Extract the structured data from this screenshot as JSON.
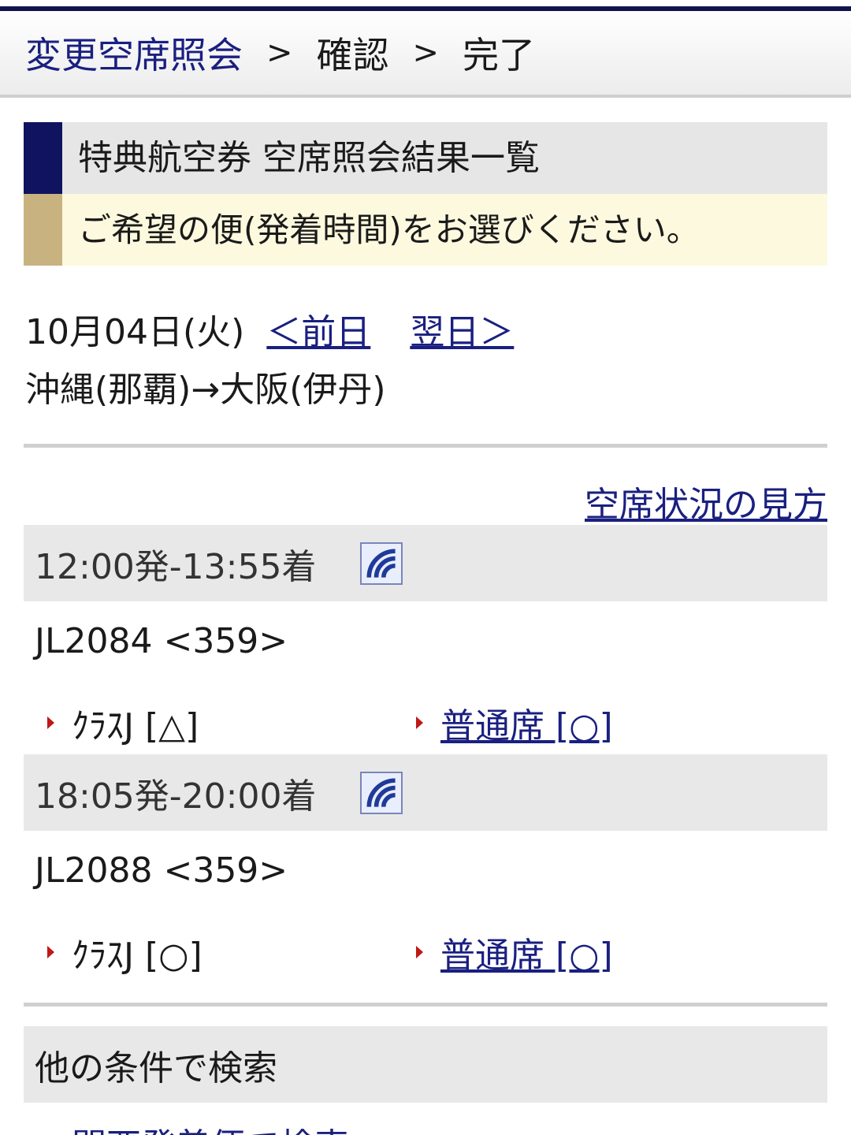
{
  "steps": {
    "current": "変更空席照会",
    "sep": ">",
    "confirm": "確認",
    "done": "完了"
  },
  "title": {
    "main": "特典航空券 空席照会結果一覧",
    "sub": "ご希望の便(発着時間)をお選びください。"
  },
  "date": {
    "label": "10月04日(火)",
    "prev": "＜前日",
    "next": "翌日＞"
  },
  "route": "沖縄(那覇)→大阪(伊丹)",
  "legend_link": "空席状況の見方",
  "flights": [
    {
      "time": "12:00発-13:55着",
      "number": "JL2084 <359>",
      "class_j": "ｸﾗｽJ [△]",
      "economy": "普通席 [○]"
    },
    {
      "time": "18:05発-20:00着",
      "number": "JL2088 <359>",
      "class_j": "ｸﾗｽJ [○]",
      "economy": "普通席 [○]"
    }
  ],
  "other_search": {
    "title": "他の条件で検索",
    "link": "関西発着便で検索"
  },
  "colors": {
    "navy": "#0f1360",
    "gold": "#c8b27f",
    "link": "#1a1f80",
    "bullet": "#c01818"
  },
  "icons": {
    "wifi": "wifi-icon",
    "bullet": "triangle-bullet-icon"
  }
}
